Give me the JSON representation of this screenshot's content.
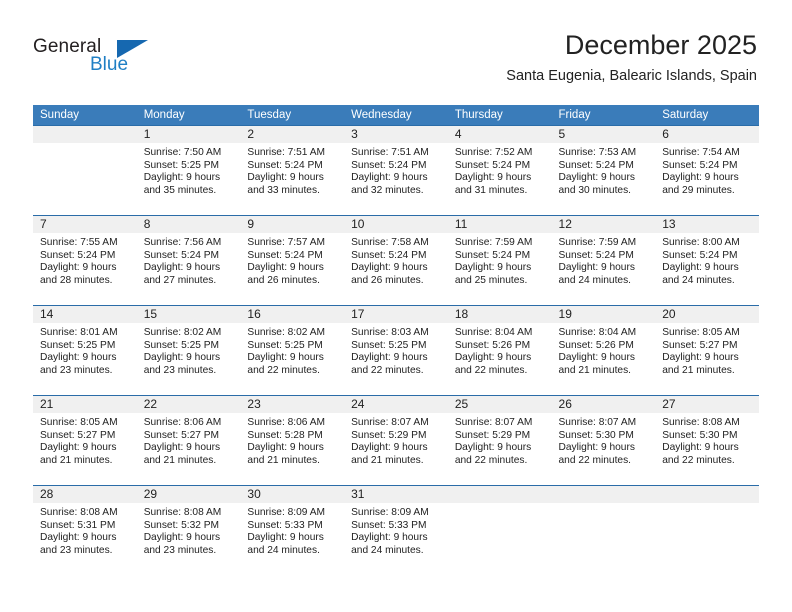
{
  "brand": {
    "name_part1": "General",
    "name_part2": "Blue",
    "accent_color": "#1f7fc4",
    "triangle_color": "#1668b0"
  },
  "header": {
    "title": "December 2025",
    "subtitle": "Santa Eugenia, Balearic Islands, Spain",
    "header_bg_color": "#3a7cba",
    "grid_line_color": "#2a6ca8",
    "daynum_band_color": "#f0f0f0"
  },
  "weekdays": [
    "Sunday",
    "Monday",
    "Tuesday",
    "Wednesday",
    "Thursday",
    "Friday",
    "Saturday"
  ],
  "weeks": [
    [
      {
        "day": "",
        "empty": true,
        "sunrise": "",
        "sunset": "",
        "daylight1": "",
        "daylight2": ""
      },
      {
        "day": "1",
        "sunrise": "Sunrise: 7:50 AM",
        "sunset": "Sunset: 5:25 PM",
        "daylight1": "Daylight: 9 hours",
        "daylight2": "and 35 minutes."
      },
      {
        "day": "2",
        "sunrise": "Sunrise: 7:51 AM",
        "sunset": "Sunset: 5:24 PM",
        "daylight1": "Daylight: 9 hours",
        "daylight2": "and 33 minutes."
      },
      {
        "day": "3",
        "sunrise": "Sunrise: 7:51 AM",
        "sunset": "Sunset: 5:24 PM",
        "daylight1": "Daylight: 9 hours",
        "daylight2": "and 32 minutes."
      },
      {
        "day": "4",
        "sunrise": "Sunrise: 7:52 AM",
        "sunset": "Sunset: 5:24 PM",
        "daylight1": "Daylight: 9 hours",
        "daylight2": "and 31 minutes."
      },
      {
        "day": "5",
        "sunrise": "Sunrise: 7:53 AM",
        "sunset": "Sunset: 5:24 PM",
        "daylight1": "Daylight: 9 hours",
        "daylight2": "and 30 minutes."
      },
      {
        "day": "6",
        "sunrise": "Sunrise: 7:54 AM",
        "sunset": "Sunset: 5:24 PM",
        "daylight1": "Daylight: 9 hours",
        "daylight2": "and 29 minutes."
      }
    ],
    [
      {
        "day": "7",
        "sunrise": "Sunrise: 7:55 AM",
        "sunset": "Sunset: 5:24 PM",
        "daylight1": "Daylight: 9 hours",
        "daylight2": "and 28 minutes."
      },
      {
        "day": "8",
        "sunrise": "Sunrise: 7:56 AM",
        "sunset": "Sunset: 5:24 PM",
        "daylight1": "Daylight: 9 hours",
        "daylight2": "and 27 minutes."
      },
      {
        "day": "9",
        "sunrise": "Sunrise: 7:57 AM",
        "sunset": "Sunset: 5:24 PM",
        "daylight1": "Daylight: 9 hours",
        "daylight2": "and 26 minutes."
      },
      {
        "day": "10",
        "sunrise": "Sunrise: 7:58 AM",
        "sunset": "Sunset: 5:24 PM",
        "daylight1": "Daylight: 9 hours",
        "daylight2": "and 26 minutes."
      },
      {
        "day": "11",
        "sunrise": "Sunrise: 7:59 AM",
        "sunset": "Sunset: 5:24 PM",
        "daylight1": "Daylight: 9 hours",
        "daylight2": "and 25 minutes."
      },
      {
        "day": "12",
        "sunrise": "Sunrise: 7:59 AM",
        "sunset": "Sunset: 5:24 PM",
        "daylight1": "Daylight: 9 hours",
        "daylight2": "and 24 minutes."
      },
      {
        "day": "13",
        "sunrise": "Sunrise: 8:00 AM",
        "sunset": "Sunset: 5:24 PM",
        "daylight1": "Daylight: 9 hours",
        "daylight2": "and 24 minutes."
      }
    ],
    [
      {
        "day": "14",
        "sunrise": "Sunrise: 8:01 AM",
        "sunset": "Sunset: 5:25 PM",
        "daylight1": "Daylight: 9 hours",
        "daylight2": "and 23 minutes."
      },
      {
        "day": "15",
        "sunrise": "Sunrise: 8:02 AM",
        "sunset": "Sunset: 5:25 PM",
        "daylight1": "Daylight: 9 hours",
        "daylight2": "and 23 minutes."
      },
      {
        "day": "16",
        "sunrise": "Sunrise: 8:02 AM",
        "sunset": "Sunset: 5:25 PM",
        "daylight1": "Daylight: 9 hours",
        "daylight2": "and 22 minutes."
      },
      {
        "day": "17",
        "sunrise": "Sunrise: 8:03 AM",
        "sunset": "Sunset: 5:25 PM",
        "daylight1": "Daylight: 9 hours",
        "daylight2": "and 22 minutes."
      },
      {
        "day": "18",
        "sunrise": "Sunrise: 8:04 AM",
        "sunset": "Sunset: 5:26 PM",
        "daylight1": "Daylight: 9 hours",
        "daylight2": "and 22 minutes."
      },
      {
        "day": "19",
        "sunrise": "Sunrise: 8:04 AM",
        "sunset": "Sunset: 5:26 PM",
        "daylight1": "Daylight: 9 hours",
        "daylight2": "and 21 minutes."
      },
      {
        "day": "20",
        "sunrise": "Sunrise: 8:05 AM",
        "sunset": "Sunset: 5:27 PM",
        "daylight1": "Daylight: 9 hours",
        "daylight2": "and 21 minutes."
      }
    ],
    [
      {
        "day": "21",
        "sunrise": "Sunrise: 8:05 AM",
        "sunset": "Sunset: 5:27 PM",
        "daylight1": "Daylight: 9 hours",
        "daylight2": "and 21 minutes."
      },
      {
        "day": "22",
        "sunrise": "Sunrise: 8:06 AM",
        "sunset": "Sunset: 5:27 PM",
        "daylight1": "Daylight: 9 hours",
        "daylight2": "and 21 minutes."
      },
      {
        "day": "23",
        "sunrise": "Sunrise: 8:06 AM",
        "sunset": "Sunset: 5:28 PM",
        "daylight1": "Daylight: 9 hours",
        "daylight2": "and 21 minutes."
      },
      {
        "day": "24",
        "sunrise": "Sunrise: 8:07 AM",
        "sunset": "Sunset: 5:29 PM",
        "daylight1": "Daylight: 9 hours",
        "daylight2": "and 21 minutes."
      },
      {
        "day": "25",
        "sunrise": "Sunrise: 8:07 AM",
        "sunset": "Sunset: 5:29 PM",
        "daylight1": "Daylight: 9 hours",
        "daylight2": "and 22 minutes."
      },
      {
        "day": "26",
        "sunrise": "Sunrise: 8:07 AM",
        "sunset": "Sunset: 5:30 PM",
        "daylight1": "Daylight: 9 hours",
        "daylight2": "and 22 minutes."
      },
      {
        "day": "27",
        "sunrise": "Sunrise: 8:08 AM",
        "sunset": "Sunset: 5:30 PM",
        "daylight1": "Daylight: 9 hours",
        "daylight2": "and 22 minutes."
      }
    ],
    [
      {
        "day": "28",
        "sunrise": "Sunrise: 8:08 AM",
        "sunset": "Sunset: 5:31 PM",
        "daylight1": "Daylight: 9 hours",
        "daylight2": "and 23 minutes."
      },
      {
        "day": "29",
        "sunrise": "Sunrise: 8:08 AM",
        "sunset": "Sunset: 5:32 PM",
        "daylight1": "Daylight: 9 hours",
        "daylight2": "and 23 minutes."
      },
      {
        "day": "30",
        "sunrise": "Sunrise: 8:09 AM",
        "sunset": "Sunset: 5:33 PM",
        "daylight1": "Daylight: 9 hours",
        "daylight2": "and 24 minutes."
      },
      {
        "day": "31",
        "sunrise": "Sunrise: 8:09 AM",
        "sunset": "Sunset: 5:33 PM",
        "daylight1": "Daylight: 9 hours",
        "daylight2": "and 24 minutes."
      },
      {
        "day": "",
        "empty": true,
        "sunrise": "",
        "sunset": "",
        "daylight1": "",
        "daylight2": ""
      },
      {
        "day": "",
        "empty": true,
        "sunrise": "",
        "sunset": "",
        "daylight1": "",
        "daylight2": ""
      },
      {
        "day": "",
        "empty": true,
        "sunrise": "",
        "sunset": "",
        "daylight1": "",
        "daylight2": ""
      }
    ]
  ]
}
